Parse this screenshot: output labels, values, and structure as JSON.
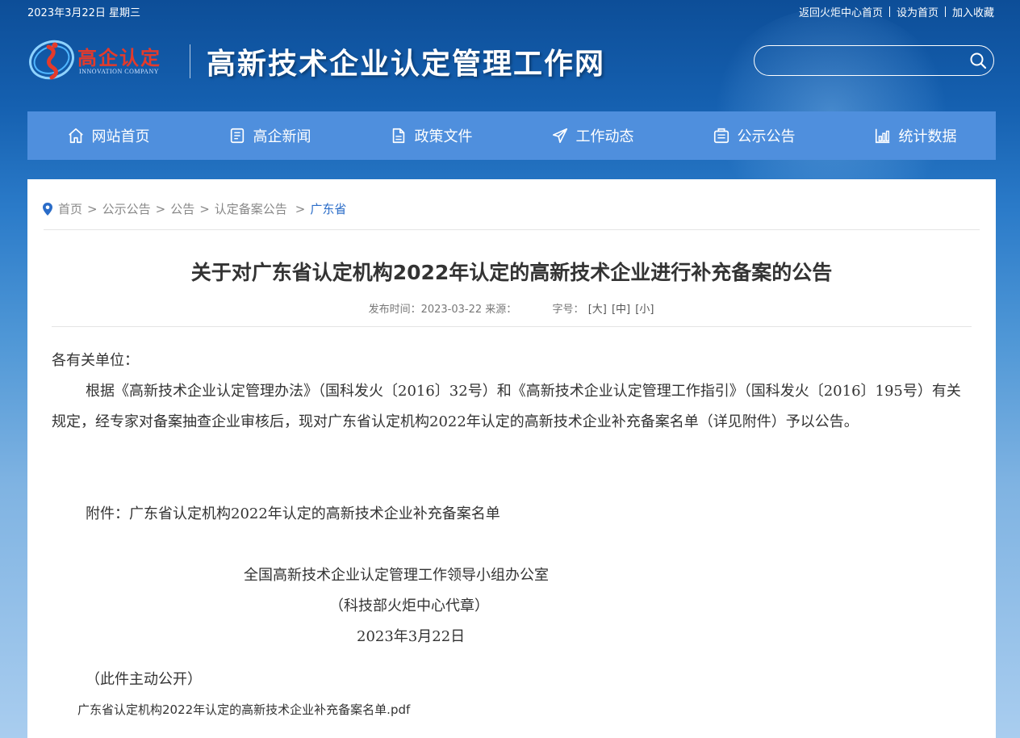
{
  "topbar": {
    "date": "2023年3月22日 星期三",
    "links": [
      "返回火炬中心首页",
      "设为首页",
      "加入收藏"
    ]
  },
  "logo": {
    "cn": "高企认定",
    "en": "INNOVATION COMPANY"
  },
  "site_title": "高新技术企业认定管理工作网",
  "search": {
    "value": ""
  },
  "nav": [
    {
      "label": "网站首页",
      "icon": "home-icon"
    },
    {
      "label": "高企新闻",
      "icon": "news-icon"
    },
    {
      "label": "政策文件",
      "icon": "document-icon"
    },
    {
      "label": "工作动态",
      "icon": "paper-plane-icon"
    },
    {
      "label": "公示公告",
      "icon": "notice-icon"
    },
    {
      "label": "统计数据",
      "icon": "chart-icon"
    }
  ],
  "breadcrumb": {
    "items": [
      "首页",
      "公示公告",
      "公告",
      "认定备案公告"
    ],
    "current": "广东省"
  },
  "article": {
    "title": "关于对广东省认定机构2022年认定的高新技术企业进行补充备案的公告",
    "publish_label": "发布时间：2023-03-22 来源：",
    "fontsize_label": "字号：",
    "fontsize_options": [
      "[大]",
      "[中]",
      "[小]"
    ],
    "greeting": "各有关单位：",
    "paragraph": "根据《高新技术企业认定管理办法》（国科发火〔2016〕32号）和《高新技术企业认定管理工作指引》（国科发火〔2016〕195号）有关规定，经专家对备案抽查企业审核后，现对广东省认定机构2022年认定的高新技术企业补充备案名单（详见附件）予以公告。",
    "attachment": "附件：广东省认定机构2022年认定的高新技术企业补充备案名单",
    "sign_org": "全国高新技术企业认定管理工作领导小组办公室",
    "sign_proxy": "（科技部火炬中心代章）",
    "sign_date": "2023年3月22日",
    "public_note": "（此件主动公开）",
    "pdf_link": "广东省认定机构2022年认定的高新技术企业补充备案名单.pdf"
  }
}
